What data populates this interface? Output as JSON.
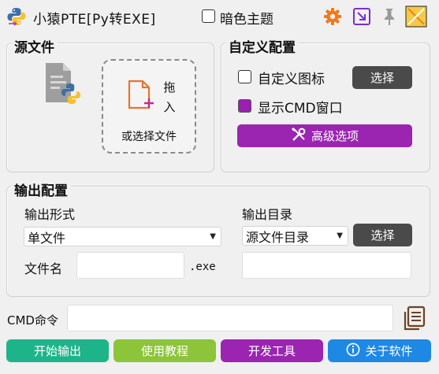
{
  "titlebar": {
    "title": "小猿PTE[Py转EXE]",
    "dark_theme_label": "暗色主题",
    "dark_theme_checked": false
  },
  "source": {
    "group_title": "源文件",
    "drop_text": "拖入",
    "choose_text": "或选择文件"
  },
  "custom": {
    "group_title": "自定义配置",
    "custom_icon_label": "自定义图标",
    "custom_icon_checked": false,
    "select_button": "选择",
    "show_cmd_label": "显示CMD窗口",
    "show_cmd_checked": true,
    "advanced_button": "高级选项"
  },
  "output": {
    "group_title": "输出配置",
    "format_label": "输出形式",
    "format_value": "单文件",
    "dir_label": "输出目录",
    "dir_value": "源文件目录",
    "dir_select_button": "选择",
    "filename_label": "文件名",
    "filename_value": "",
    "ext": ".exe",
    "dir_path_value": ""
  },
  "cmd": {
    "label": "CMD命令",
    "value": ""
  },
  "buttons": {
    "start": "开始输出",
    "tutorial": "使用教程",
    "dev_tools": "开发工具",
    "about": "关于软件"
  },
  "colors": {
    "accent_purple": "#9b24b0",
    "start_green": "#1eb489",
    "tutorial_green": "#8cc43a",
    "dev_purple": "#9b24b0",
    "about_blue": "#1e88e5",
    "gear_orange": "#f0781e"
  }
}
